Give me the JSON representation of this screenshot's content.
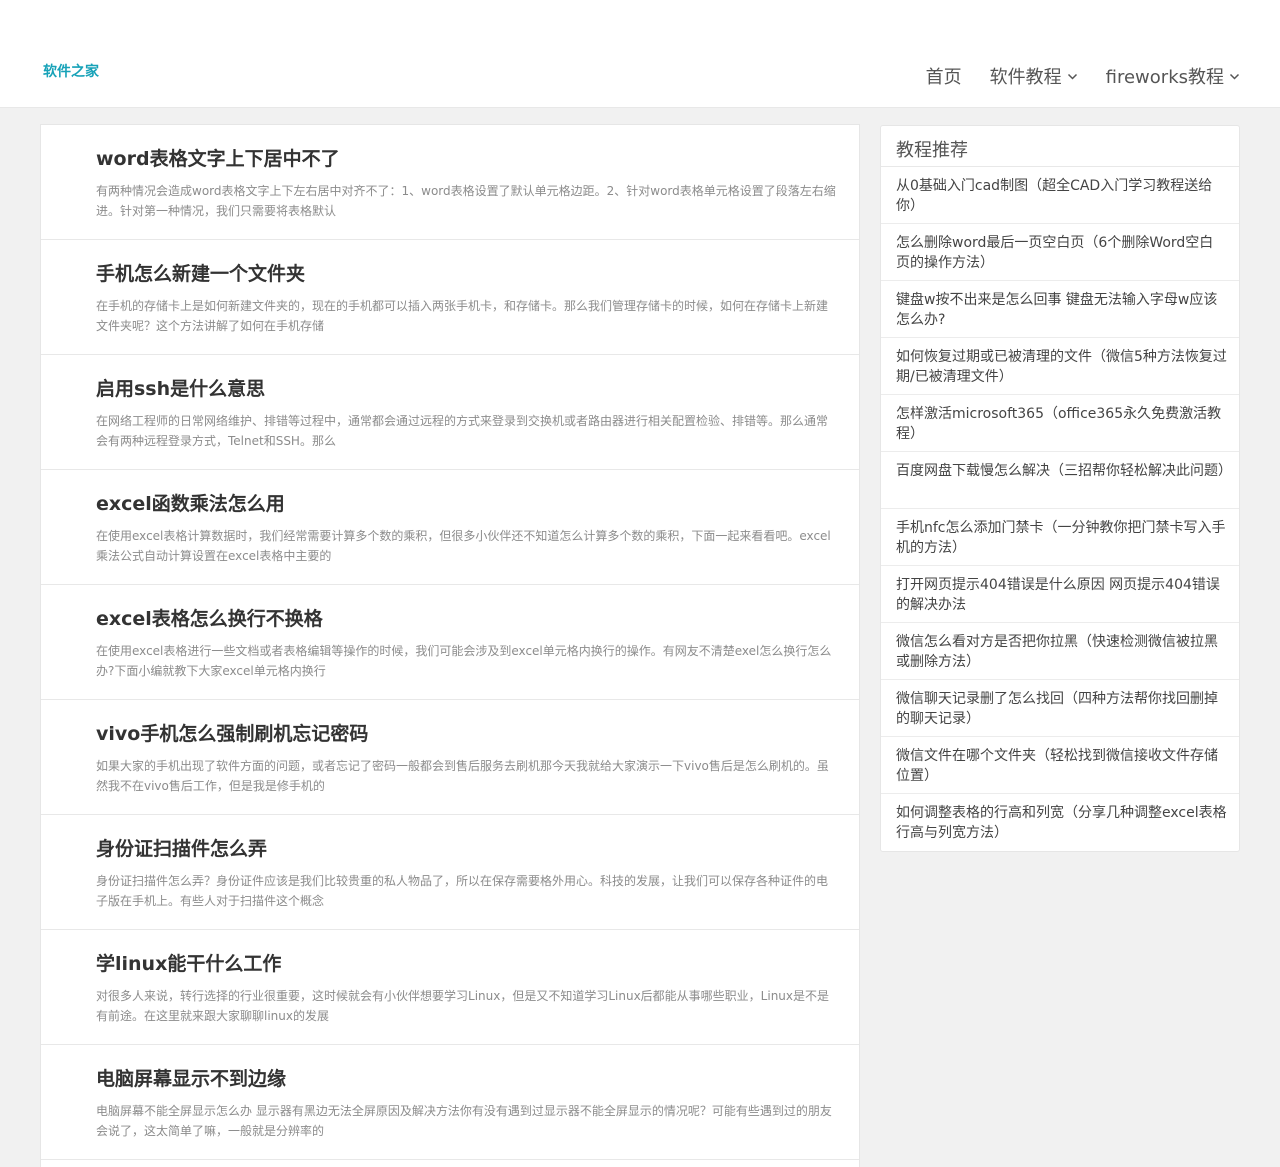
{
  "header": {
    "logo": "软件之家",
    "nav": [
      {
        "label": "首页",
        "has_dropdown": false
      },
      {
        "label": "软件教程",
        "has_dropdown": true
      },
      {
        "label": "fireworks教程",
        "has_dropdown": true
      }
    ]
  },
  "articles": [
    {
      "title": "word表格文字上下居中不了",
      "excerpt": "有两种情况会造成word表格文字上下左右居中对齐不了：1、word表格设置了默认单元格边距。2、针对word表格单元格设置了段落左右缩进。针对第一种情况，我们只需要将表格默认"
    },
    {
      "title": "手机怎么新建一个文件夹",
      "excerpt": "在手机的存储卡上是如何新建文件夹的，现在的手机都可以插入两张手机卡，和存储卡。那么我们管理存储卡的时候，如何在存储卡上新建文件夹呢？这个方法讲解了如何在手机存储"
    },
    {
      "title": "启用ssh是什么意思",
      "excerpt": "在网络工程师的日常网络维护、排错等过程中，通常都会通过远程的方式来登录到交换机或者路由器进行相关配置检验、排错等。那么通常会有两种远程登录方式，Telnet和SSH。那么"
    },
    {
      "title": "excel函数乘法怎么用",
      "excerpt": "在使用excel表格计算数据时，我们经常需要计算多个数的乘积，但很多小伙伴还不知道怎么计算多个数的乘积，下面一起来看看吧。excel乘法公式自动计算设置在excel表格中主要的"
    },
    {
      "title": "excel表格怎么换行不换格",
      "excerpt": "在使用excel表格进行一些文档或者表格编辑等操作的时候，我们可能会涉及到excel单元格内换行的操作。有网友不清楚exel怎么换行怎么办?下面小编就教下大家excel单元格内换行"
    },
    {
      "title": "vivo手机怎么强制刷机忘记密码",
      "excerpt": "如果大家的手机出现了软件方面的问题，或者忘记了密码一般都会到售后服务去刷机那今天我就给大家演示一下vivo售后是怎么刷机的。虽然我不在vivo售后工作，但是我是修手机的"
    },
    {
      "title": "身份证扫描件怎么弄",
      "excerpt": "身份证扫描件怎么弄？身份证件应该是我们比较贵重的私人物品了，所以在保存需要格外用心。科技的发展，让我们可以保存各种证件的电子版在手机上。有些人对于扫描件这个概念"
    },
    {
      "title": "学linux能干什么工作",
      "excerpt": "对很多人来说，转行选择的行业很重要，这时候就会有小伙伴想要学习Linux，但是又不知道学习Linux后都能从事哪些职业，Linux是不是有前途。在这里就来跟大家聊聊linux的发展"
    },
    {
      "title": "电脑屏幕显示不到边缘",
      "excerpt": "电脑屏幕不能全屏显示怎么办 显示器有黑边无法全屏原因及解决方法你有没有遇到过显示器不能全屏显示的情况呢？可能有些遇到过的朋友会说了，这太简单了嘛，一般就是分辨率的"
    }
  ],
  "sidebar": {
    "title": "教程推荐",
    "items": [
      "从0基础入门cad制图（超全CAD入门学习教程送给你）",
      "怎么删除word最后一页空白页（6个删除Word空白页的操作方法）",
      "键盘w按不出来是怎么回事 键盘无法输入字母w应该怎么办?",
      "如何恢复过期或已被清理的文件（微信5种方法恢复过期/已被清理文件）",
      "怎样激活microsoft365（office365永久免费激活教程）",
      "百度网盘下载慢怎么解决（三招帮你轻松解决此问题）",
      "手机nfc怎么添加门禁卡（一分钟教你把门禁卡写入手机的方法）",
      "打开网页提示404错误是什么原因 网页提示404错误的解决办法",
      "微信怎么看对方是否把你拉黑（快速检测微信被拉黑或删除方法）",
      "微信聊天记录删了怎么找回（四种方法帮你找回删掉的聊天记录）",
      "微信文件在哪个文件夹（轻松找到微信接收文件存储位置）",
      "如何调整表格的行高和列宽（分享几种调整excel表格行高与列宽方法）"
    ]
  },
  "colors": {
    "accent": "#17a2b8",
    "background": "#f1f1f1"
  }
}
